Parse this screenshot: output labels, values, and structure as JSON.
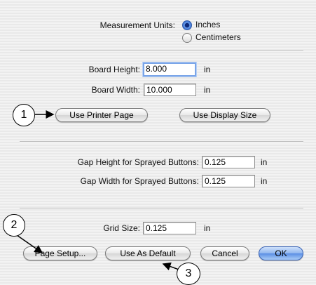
{
  "units": {
    "label": "Measurement Units:",
    "options": [
      {
        "label": "Inches",
        "selected": true
      },
      {
        "label": "Centimeters",
        "selected": false
      }
    ]
  },
  "board": {
    "height_label": "Board Height:",
    "height_value": "8.000",
    "height_unit": "in",
    "width_label": "Board Width:",
    "width_value": "10.000",
    "width_unit": "in"
  },
  "buttons": {
    "use_printer_page": "Use Printer Page",
    "use_display_size": "Use Display Size",
    "page_setup": "Page Setup...",
    "use_as_default": "Use As Default",
    "cancel": "Cancel",
    "ok": "OK"
  },
  "gaps": {
    "height_label": "Gap Height for Sprayed Buttons:",
    "height_value": "0.125",
    "height_unit": "in",
    "width_label": "Gap Width for Sprayed Buttons:",
    "width_value": "0.125",
    "width_unit": "in"
  },
  "grid": {
    "label": "Grid Size:",
    "value": "0.125",
    "unit": "in"
  },
  "callouts": [
    "1",
    "2",
    "3"
  ],
  "colors": {
    "default_button": "#5a8ee4",
    "focus_ring": "#7aa5e8"
  }
}
